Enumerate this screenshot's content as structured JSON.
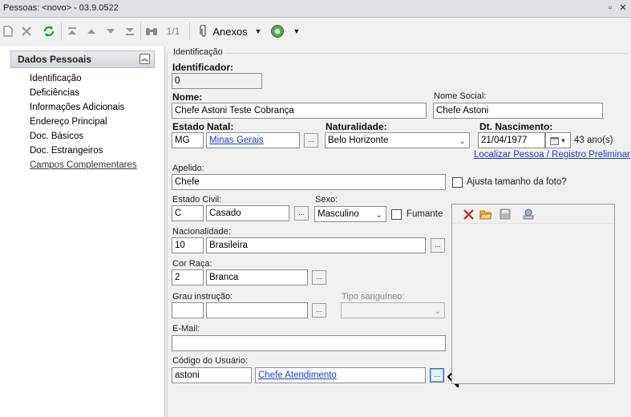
{
  "window": {
    "title": "Pessoas: <novo> - 03.9.0522",
    "pin": "▫",
    "close": "✕"
  },
  "toolbar": {
    "nav_record": "1/1",
    "attachments_label": "Anexos"
  },
  "sidebar": {
    "header": "Dados Pessoais",
    "items": [
      {
        "label": "Identificação"
      },
      {
        "label": "Deficiências"
      },
      {
        "label": "Informações Adicionais"
      },
      {
        "label": "Endereço Principal"
      },
      {
        "label": "Doc. Básicos"
      },
      {
        "label": "Doc. Estrangeiros"
      },
      {
        "label": "Campos Complementares"
      }
    ]
  },
  "form": {
    "group_title": "Identificação",
    "identificador": {
      "label": "Identificador:",
      "value": "0"
    },
    "nome": {
      "label": "Nome:",
      "value": "Chefe Astoni Teste Cobrança"
    },
    "nome_social": {
      "label": "Nome Social:",
      "value": "Chefe Astoni"
    },
    "estado": {
      "label": "Estado",
      "value": "MG"
    },
    "natal": {
      "label": "Natal:",
      "value": "Minas Gerais"
    },
    "naturalidade": {
      "label": "Naturalidade:",
      "value": "Belo Horizonte"
    },
    "dt_nascimento": {
      "label": "Dt. Nascimento:",
      "value": "21/04/1977",
      "age": "43 ano(s)"
    },
    "localizar_link": "Localizar Pessoa / Registro Preliminar",
    "apelido": {
      "label": "Apelido:",
      "value": "Chefe"
    },
    "ajusta_foto": "Ajusta tamanho da foto?",
    "estado_civil": {
      "label": "Estado Civil:",
      "code": "C",
      "value": "Casado"
    },
    "sexo": {
      "label": "Sexo:",
      "value": "Masculino"
    },
    "fumante": "Fumante",
    "nacionalidade": {
      "label": "Nacionalidade:",
      "code": "10",
      "value": "Brasileira"
    },
    "cor_raca": {
      "label": "Cor Raça:",
      "code": "2",
      "value": "Branca"
    },
    "grau_instrucao": {
      "label": "Grau instrução:",
      "code": "",
      "value": ""
    },
    "tipo_sanguineo": {
      "label": "Tipo sanguíneo:",
      "value": ""
    },
    "email": {
      "label": "E-Mail:",
      "value": ""
    },
    "codigo_usuario": {
      "label": "Código do Usuário:",
      "code": "astoni",
      "value": "Chefe Atendimento"
    },
    "dots": "..."
  },
  "colors": {
    "link": "#1b3cc6",
    "delete_icon": "#d62020",
    "highlight_border": "#2b6cd8"
  }
}
